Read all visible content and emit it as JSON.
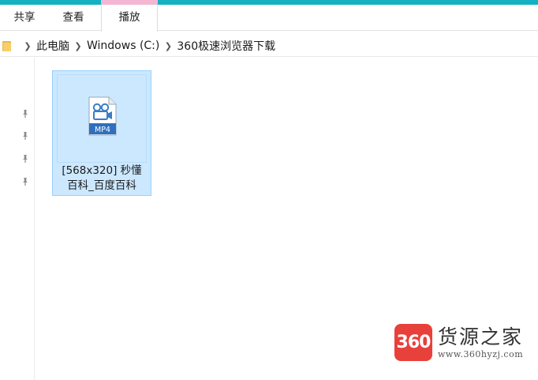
{
  "ribbon": {
    "tabs": [
      {
        "label": "共享"
      },
      {
        "label": "查看"
      },
      {
        "label": "播放"
      }
    ]
  },
  "address": {
    "crumbs": [
      "此电脑",
      "Windows (C:)",
      "360极速浏览器下载"
    ],
    "folder_icon": "folder-icon",
    "separator_icon": "chevron-right-icon"
  },
  "nav": {
    "pin_icon": "pin-icon",
    "pin_count": 4
  },
  "file": {
    "name_line1": "[568x320] 秒懂",
    "name_line2": "百科_百度百科",
    "type_label": "MP4",
    "icon": "video-file-icon"
  },
  "watermark": {
    "badge": "360",
    "title": "货源之家",
    "url": "www.360hyzj.com"
  },
  "colors": {
    "accent": "#14b1c2",
    "active_tab": "#f3b6d3",
    "selection_bg": "#cce8ff",
    "selection_border": "#99d1ff",
    "watermark_red": "#e8403b"
  }
}
